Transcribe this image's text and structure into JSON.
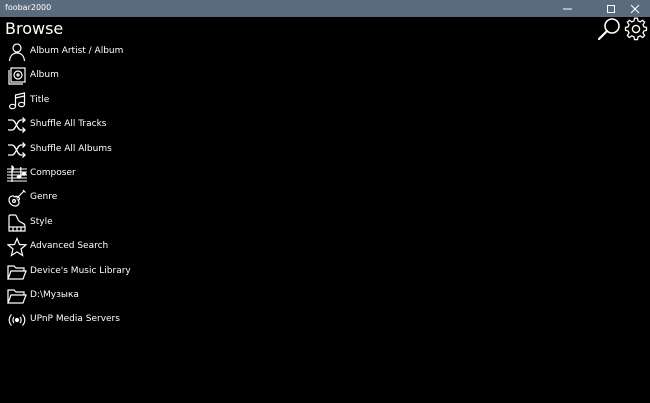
{
  "window": {
    "title": "foobar2000"
  },
  "page": {
    "title": "Browse"
  },
  "browse_items": [
    {
      "label": "Album Artist / Album",
      "icon": "person-icon"
    },
    {
      "label": "Album",
      "icon": "album-icon"
    },
    {
      "label": "Title",
      "icon": "music-note-icon"
    },
    {
      "label": "Shuffle All Tracks",
      "icon": "shuffle-icon"
    },
    {
      "label": "Shuffle All Albums",
      "icon": "shuffle-icon"
    },
    {
      "label": "Composer",
      "icon": "sheet-music-icon"
    },
    {
      "label": "Genre",
      "icon": "guitar-icon"
    },
    {
      "label": "Style",
      "icon": "piano-icon"
    },
    {
      "label": "Advanced Search",
      "icon": "star-icon"
    },
    {
      "label": "Device's Music Library",
      "icon": "folder-icon"
    },
    {
      "label": "D:\\Музыка",
      "icon": "folder-icon"
    },
    {
      "label": "UPnP Media Servers",
      "icon": "broadcast-icon"
    }
  ],
  "colors": {
    "titlebar": "#5b6b7e",
    "background": "#000000",
    "foreground": "#ffffff"
  }
}
